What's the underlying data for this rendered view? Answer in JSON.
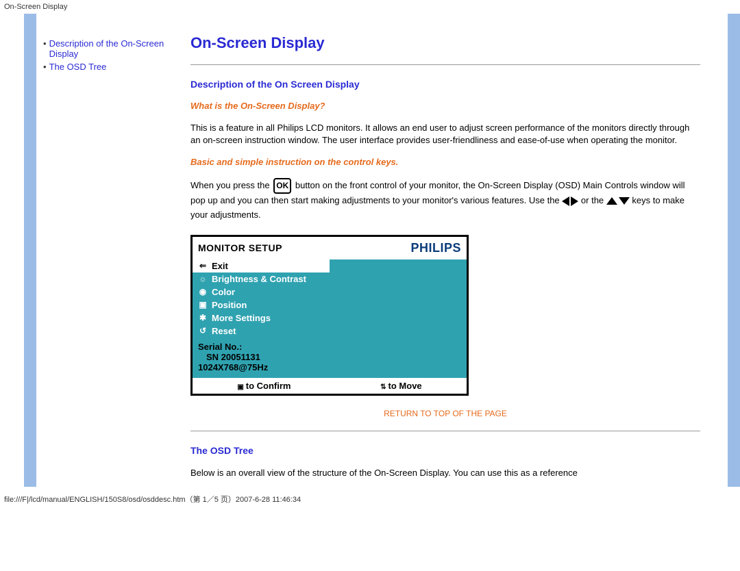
{
  "topbar": "On-Screen Display",
  "sidebar": {
    "items": [
      {
        "label": "Description of the On-Screen Display"
      },
      {
        "label": "The OSD Tree"
      }
    ]
  },
  "main": {
    "title": "On-Screen Display",
    "section1_heading": "Description of the On Screen Display",
    "sub1": "What is the On-Screen Display?",
    "para1": "This is a feature in all Philips LCD monitors. It allows an end user to adjust screen performance of the monitors directly through an on-screen instruction window. The user interface provides user-friendliness and ease-of-use when operating the monitor.",
    "sub2": "Basic and simple instruction on the control keys.",
    "para2_a": "When you press the",
    "para2_b": "button on the front control of your monitor, the On-Screen Display (OSD) Main Controls window will pop up and you can then start making adjustments to your monitor's various features. Use the",
    "para2_c": "or the",
    "para2_d": "keys to make your adjustments.",
    "return_link": "RETURN TO TOP OF THE PAGE",
    "section2_heading": "The OSD Tree",
    "para3": "Below is an overall view of the structure of the On-Screen Display. You can use this as a reference"
  },
  "osd": {
    "header_title": "MONITOR SETUP",
    "brand": "PHILIPS",
    "items": [
      {
        "icon": "⇐",
        "label": "Exit",
        "active": true
      },
      {
        "icon": "☼",
        "label": "Brightness & Contrast",
        "active": false
      },
      {
        "icon": "◉",
        "label": "Color",
        "active": false
      },
      {
        "icon": "▣",
        "label": "Position",
        "active": false
      },
      {
        "icon": "✱",
        "label": "More Settings",
        "active": false
      },
      {
        "icon": "↺",
        "label": "Reset",
        "active": false
      }
    ],
    "serial_label": "Serial No.:",
    "serial_value": "SN 20051131",
    "resolution": "1024X768@75Hz",
    "footer_confirm": "to Confirm",
    "footer_move": "to Move"
  },
  "footer_path": "file:///F|/lcd/manual/ENGLISH/150S8/osd/osddesc.htm（第 1／5 页）2007-6-28 11:46:34"
}
